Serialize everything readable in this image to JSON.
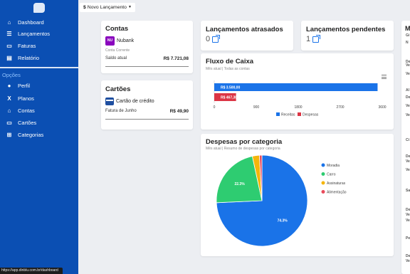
{
  "sidebar": {
    "items": [
      {
        "label": "Dashboard",
        "icon": "home-icon"
      },
      {
        "label": "Lançamentos",
        "icon": "list-icon"
      },
      {
        "label": "Faturas",
        "icon": "card-icon"
      },
      {
        "label": "Relatório",
        "icon": "report-icon"
      }
    ],
    "section_label": "Opções",
    "options": [
      {
        "label": "Perfil",
        "icon": "user-icon"
      },
      {
        "label": "Planos",
        "icon": "plan-icon"
      },
      {
        "label": "Contas",
        "icon": "bank-icon"
      },
      {
        "label": "Cartões",
        "icon": "card-icon"
      },
      {
        "label": "Categorias",
        "icon": "sitemap-icon"
      }
    ]
  },
  "toolbar": {
    "new_entry_label": "Novo Lançamento",
    "currency_symbol": "$"
  },
  "accounts": {
    "title": "Contas",
    "bank_badge": "NU",
    "bank_name": "Nubank",
    "account_type": "Conta Corrente",
    "balance_label": "Saldo atual",
    "balance_value": "R$ 7.721,08"
  },
  "cards": {
    "title": "Cartões",
    "card_name": "Cartão de crédito",
    "invoice_label": "Fatura de Junho",
    "invoice_value": "R$ 49,90"
  },
  "overdue": {
    "title": "Lançamentos atrasados",
    "count": "0"
  },
  "pending": {
    "title": "Lançamentos pendentes",
    "count": "1"
  },
  "cashflow": {
    "title": "Fluxo de Caixa",
    "subtitle": "Mês atual | Todas as contas"
  },
  "expenses": {
    "title": "Despesas por categoria",
    "subtitle": "Mês atual | Resumo de despesas por categoria"
  },
  "right_panel": {
    "title": "M",
    "lines": [
      "Gi",
      "N",
      "De",
      "Ve",
      "Ve",
      "Al",
      "De",
      "Ve",
      "Ve",
      "Ci",
      "De",
      "Ve",
      "Ve",
      "Sa",
      "De",
      "Ve",
      "Ve",
      "Pe",
      "De",
      "Ve"
    ]
  },
  "statusbar": {
    "url": "https://app.dinblu.com.br/dashboard"
  },
  "colors": {
    "sidebar": "#0b4fb3",
    "receitas": "#1a73e8",
    "despesas": "#dc3545",
    "moradia": "#1a73e8",
    "carro": "#2ecc71",
    "assinaturas": "#f5b50a",
    "alimentacao": "#e94b5b"
  },
  "chart_data": [
    {
      "type": "bar",
      "orientation": "horizontal",
      "categories": [
        "Receitas",
        "Despesas"
      ],
      "values": [
        3500,
        467.3
      ],
      "data_labels": [
        "R$ 3.500,00",
        "R$ 467,30"
      ],
      "x_ticks": [
        "0",
        "900",
        "1800",
        "2700",
        "3600"
      ],
      "xlim": [
        0,
        3600
      ],
      "legend": [
        "Receitas",
        "Despesas"
      ],
      "legend_position": "bottom"
    },
    {
      "type": "pie",
      "labels": [
        "Moradia",
        "Carro",
        "Assinaturas",
        "Alimentação"
      ],
      "values": [
        74.3,
        22.3,
        2.5,
        0.9
      ],
      "data_labels": [
        "74.3%",
        "22.3%",
        "",
        ""
      ],
      "legend_position": "right"
    }
  ]
}
